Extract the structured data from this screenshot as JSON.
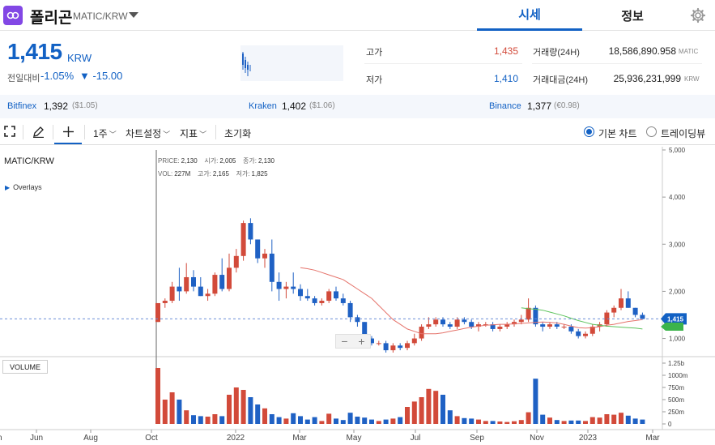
{
  "header": {
    "coin_name": "폴리곤",
    "pair": "MATIC/KRW",
    "tabs": [
      "시세",
      "정보"
    ]
  },
  "quote": {
    "price": "1,415",
    "unit": "KRW",
    "change_label": "전일대비",
    "change_rate": "-1.05%",
    "change_amount": "▼ -15.00",
    "high_label": "고가",
    "high": "1,435",
    "low_label": "저가",
    "low": "1,410",
    "volume_label": "거래량(24H)",
    "volume": "18,586,890.958",
    "volume_unit": "MATIC",
    "turnover_label": "거래대금(24H)",
    "turnover": "25,936,231,999",
    "turnover_unit": "KRW"
  },
  "exchanges": [
    {
      "name": "Bitfinex",
      "price": "1,392",
      "sub": "($1.05)"
    },
    {
      "name": "Kraken",
      "price": "1,402",
      "sub": "($1.06)"
    },
    {
      "name": "Binance",
      "price": "1,377",
      "sub": "(€0.98)"
    }
  ],
  "toolbar": {
    "period": "1주",
    "settings": "차트설정",
    "indicator": "지표",
    "reset": "초기화",
    "basic_chart": "기본 차트",
    "tradingview": "트레이딩뷰"
  },
  "chart": {
    "title": "MATIC/KRW",
    "overlays": "Overlays",
    "volume_label": "VOLUME",
    "ohlc": {
      "price_k": "PRICE:",
      "price": "2,130",
      "open_k": "시가:",
      "open": "2,005",
      "close_k": "종가:",
      "close": "2,130",
      "vol_k": "VOL:",
      "vol": "227M",
      "high_k": "고가:",
      "high": "2,165",
      "low_k": "저가:",
      "low": "1,825"
    },
    "current_tag": "1,415",
    "colors": {
      "up": "#d24a3a",
      "down": "#1f61c4",
      "ma1": "#e5736b",
      "ma2": "#5cc35c",
      "accent": "#1261c4"
    }
  },
  "chart_data": {
    "type": "candlestick",
    "y_ticks": [
      "5,000",
      "4,000",
      "3,000",
      "2,000",
      "1,000"
    ],
    "y_range": [
      700,
      5000
    ],
    "vol_ticks": [
      "1.25b",
      "1000m",
      "750m",
      "500m",
      "250m",
      "0"
    ],
    "vol_range": [
      0,
      1250
    ],
    "x_ticks": [
      "un",
      "Jun",
      "Aug",
      "Oct",
      "2022",
      "Mar",
      "May",
      "Jul",
      "Sep",
      "Nov",
      "2023",
      "Mar"
    ],
    "candles": [
      [
        1350,
        1750,
        1350,
        1750,
        1150
      ],
      [
        1750,
        1850,
        1650,
        1800,
        500
      ],
      [
        1800,
        2200,
        1750,
        2100,
        650
      ],
      [
        2100,
        2500,
        1800,
        2000,
        500
      ],
      [
        2000,
        2600,
        1950,
        2300,
        280
      ],
      [
        2300,
        2450,
        2000,
        2100,
        180
      ],
      [
        2100,
        2300,
        1900,
        1900,
        160
      ],
      [
        1900,
        2050,
        1800,
        1950,
        150
      ],
      [
        1950,
        2400,
        1900,
        2350,
        200
      ],
      [
        2350,
        2700,
        2000,
        2050,
        160
      ],
      [
        2050,
        2800,
        2000,
        2500,
        600
      ],
      [
        2500,
        2900,
        2400,
        2750,
        750
      ],
      [
        2750,
        3500,
        2650,
        3450,
        700
      ],
      [
        3450,
        3550,
        3000,
        3100,
        550
      ],
      [
        3100,
        3100,
        2600,
        2700,
        400
      ],
      [
        2700,
        2900,
        2500,
        2800,
        320
      ],
      [
        2800,
        3100,
        2000,
        2200,
        200
      ],
      [
        2200,
        2400,
        1800,
        2050,
        140
      ],
      [
        2050,
        2200,
        1850,
        2100,
        110
      ],
      [
        2100,
        2400,
        1950,
        2050,
        220
      ],
      [
        2050,
        2150,
        1800,
        1900,
        160
      ],
      [
        1900,
        2050,
        1800,
        1850,
        90
      ],
      [
        1850,
        1900,
        1700,
        1750,
        140
      ],
      [
        1750,
        1850,
        1700,
        1800,
        60
      ],
      [
        1800,
        2050,
        1750,
        2000,
        210
      ],
      [
        2000,
        2100,
        1800,
        1850,
        110
      ],
      [
        1850,
        1950,
        1700,
        1750,
        80
      ],
      [
        1750,
        1800,
        1350,
        1450,
        230
      ],
      [
        1450,
        1500,
        1250,
        1350,
        150
      ],
      [
        1350,
        1350,
        900,
        1000,
        130
      ],
      [
        1000,
        1050,
        850,
        900,
        90
      ],
      [
        900,
        950,
        850,
        900,
        60
      ],
      [
        900,
        950,
        700,
        750,
        90
      ],
      [
        750,
        900,
        700,
        850,
        110
      ],
      [
        850,
        900,
        750,
        800,
        140
      ],
      [
        800,
        950,
        750,
        900,
        350
      ],
      [
        900,
        1100,
        850,
        1000,
        460
      ],
      [
        1000,
        1300,
        950,
        1250,
        550
      ],
      [
        1250,
        1450,
        1200,
        1300,
        720
      ],
      [
        1300,
        1450,
        1250,
        1400,
        680
      ],
      [
        1400,
        1450,
        1250,
        1300,
        600
      ],
      [
        1300,
        1350,
        1200,
        1250,
        280
      ],
      [
        1250,
        1450,
        1200,
        1400,
        160
      ],
      [
        1400,
        1450,
        1300,
        1350,
        120
      ],
      [
        1350,
        1400,
        1200,
        1250,
        110
      ],
      [
        1250,
        1350,
        1150,
        1300,
        90
      ],
      [
        1300,
        1350,
        1250,
        1300,
        60
      ],
      [
        1300,
        1350,
        1150,
        1200,
        60
      ],
      [
        1200,
        1300,
        1150,
        1250,
        50
      ],
      [
        1250,
        1350,
        1200,
        1300,
        40
      ],
      [
        1300,
        1400,
        1250,
        1350,
        55
      ],
      [
        1350,
        1500,
        1300,
        1400,
        80
      ],
      [
        1400,
        1850,
        1350,
        1650,
        240
      ],
      [
        1650,
        1700,
        1250,
        1300,
        930
      ],
      [
        1300,
        1350,
        1150,
        1250,
        190
      ],
      [
        1250,
        1350,
        1200,
        1300,
        130
      ],
      [
        1300,
        1350,
        1200,
        1250,
        80
      ],
      [
        1250,
        1300,
        1200,
        1250,
        60
      ],
      [
        1250,
        1300,
        1100,
        1150,
        70
      ],
      [
        1150,
        1200,
        1000,
        1050,
        70
      ],
      [
        1050,
        1150,
        1000,
        1100,
        60
      ],
      [
        1100,
        1300,
        1050,
        1250,
        140
      ],
      [
        1250,
        1350,
        1150,
        1300,
        130
      ],
      [
        1300,
        1600,
        1250,
        1550,
        200
      ],
      [
        1550,
        1700,
        1450,
        1650,
        190
      ],
      [
        1650,
        2050,
        1600,
        1850,
        230
      ],
      [
        1850,
        2000,
        1650,
        1650,
        170
      ],
      [
        1650,
        1650,
        1450,
        1500,
        110
      ],
      [
        1500,
        1550,
        1400,
        1415,
        90
      ]
    ],
    "ma_long": [
      null,
      null,
      null,
      null,
      null,
      null,
      null,
      null,
      null,
      null,
      null,
      null,
      null,
      null,
      null,
      null,
      null,
      null,
      null,
      null,
      2500,
      2480,
      2450,
      2400,
      2350,
      2300,
      2250,
      2150,
      2050,
      1950,
      1850,
      1700,
      1550,
      1400,
      1300,
      1200,
      1150,
      1100,
      1100,
      1100,
      1120,
      1150,
      1180,
      1210,
      1240,
      1260,
      1280,
      1290,
      1300,
      1300,
      1310,
      1320,
      1330,
      1340,
      1350,
      1340,
      1330,
      1300,
      1260,
      1230,
      1220,
      1230,
      1250,
      1280,
      1300,
      1330,
      1360,
      1380,
      1400
    ],
    "ma_short": [
      null,
      null,
      null,
      null,
      null,
      null,
      null,
      null,
      null,
      null,
      null,
      null,
      null,
      null,
      null,
      null,
      null,
      null,
      null,
      null,
      null,
      null,
      null,
      null,
      null,
      null,
      null,
      null,
      null,
      null,
      null,
      null,
      null,
      null,
      null,
      null,
      null,
      null,
      null,
      null,
      null,
      null,
      null,
      null,
      null,
      null,
      null,
      null,
      null,
      null,
      null,
      1650,
      1630,
      1620,
      1600,
      1560,
      1520,
      1480,
      1430,
      1380,
      1340,
      1300,
      1280,
      1260,
      1250,
      1240,
      1230,
      1220,
      1200
    ]
  }
}
